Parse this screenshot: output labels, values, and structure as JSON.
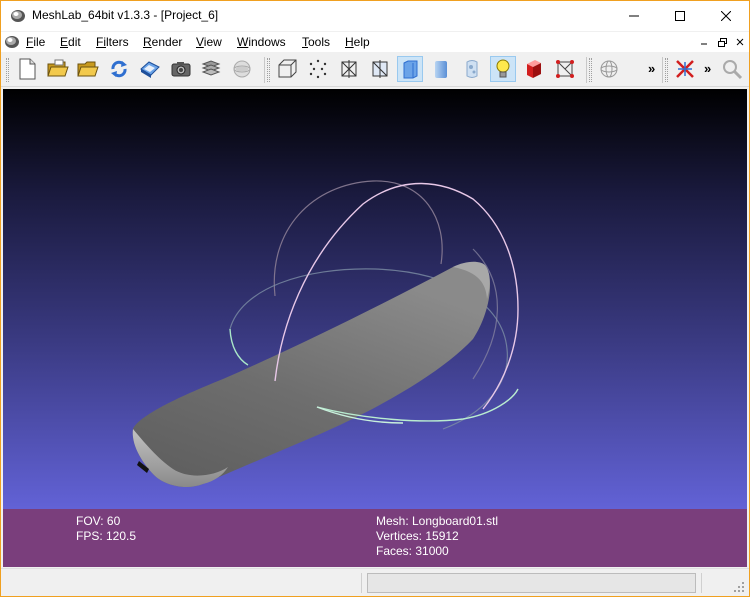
{
  "window": {
    "title": "MeshLab_64bit v1.3.3 - [Project_6]",
    "accent_border": "#f0a020"
  },
  "menu": {
    "items": [
      {
        "label": "File",
        "underline": "F",
        "rest": "ile"
      },
      {
        "label": "Edit",
        "underline": "E",
        "rest": "dit"
      },
      {
        "label": "Filters",
        "underline": "Fi",
        "rest": "lters"
      },
      {
        "label": "Render",
        "underline": "R",
        "rest": "ender"
      },
      {
        "label": "View",
        "underline": "V",
        "rest": "iew"
      },
      {
        "label": "Windows",
        "underline": "W",
        "rest": "indows"
      },
      {
        "label": "Tools",
        "underline": "T",
        "rest": "ools"
      },
      {
        "label": "Help",
        "underline": "H",
        "rest": "elp"
      }
    ]
  },
  "toolbar": {
    "buttons": [
      "new-project-icon",
      "open-project-icon",
      "open-mesh-icon",
      "reload-icon",
      "save-icon",
      "snapshot-icon",
      "layers-icon",
      "disabled-sphere-icon",
      "bbox-icon",
      "points-icon",
      "wireframe-icon",
      "hidden-lines-icon",
      "flat-shading-icon",
      "smooth-shading-icon",
      "texture-icon",
      "light-icon",
      "backface-icon",
      "selected-faces-icon",
      "trackball-icon",
      "manipulator-icon",
      "zoom-icon"
    ],
    "overflow_label": "»"
  },
  "viewport": {
    "background_top": "#000000",
    "background_bottom": "#6262d6"
  },
  "info": {
    "fov": "FOV: 60",
    "fps": "FPS:   120.5",
    "mesh": "Mesh: Longboard01.stl",
    "vertices": "Vertices: 15912",
    "faces": "Faces: 31000",
    "background": "#7a3e7c"
  },
  "statusbar": {
    "progress": 0
  }
}
